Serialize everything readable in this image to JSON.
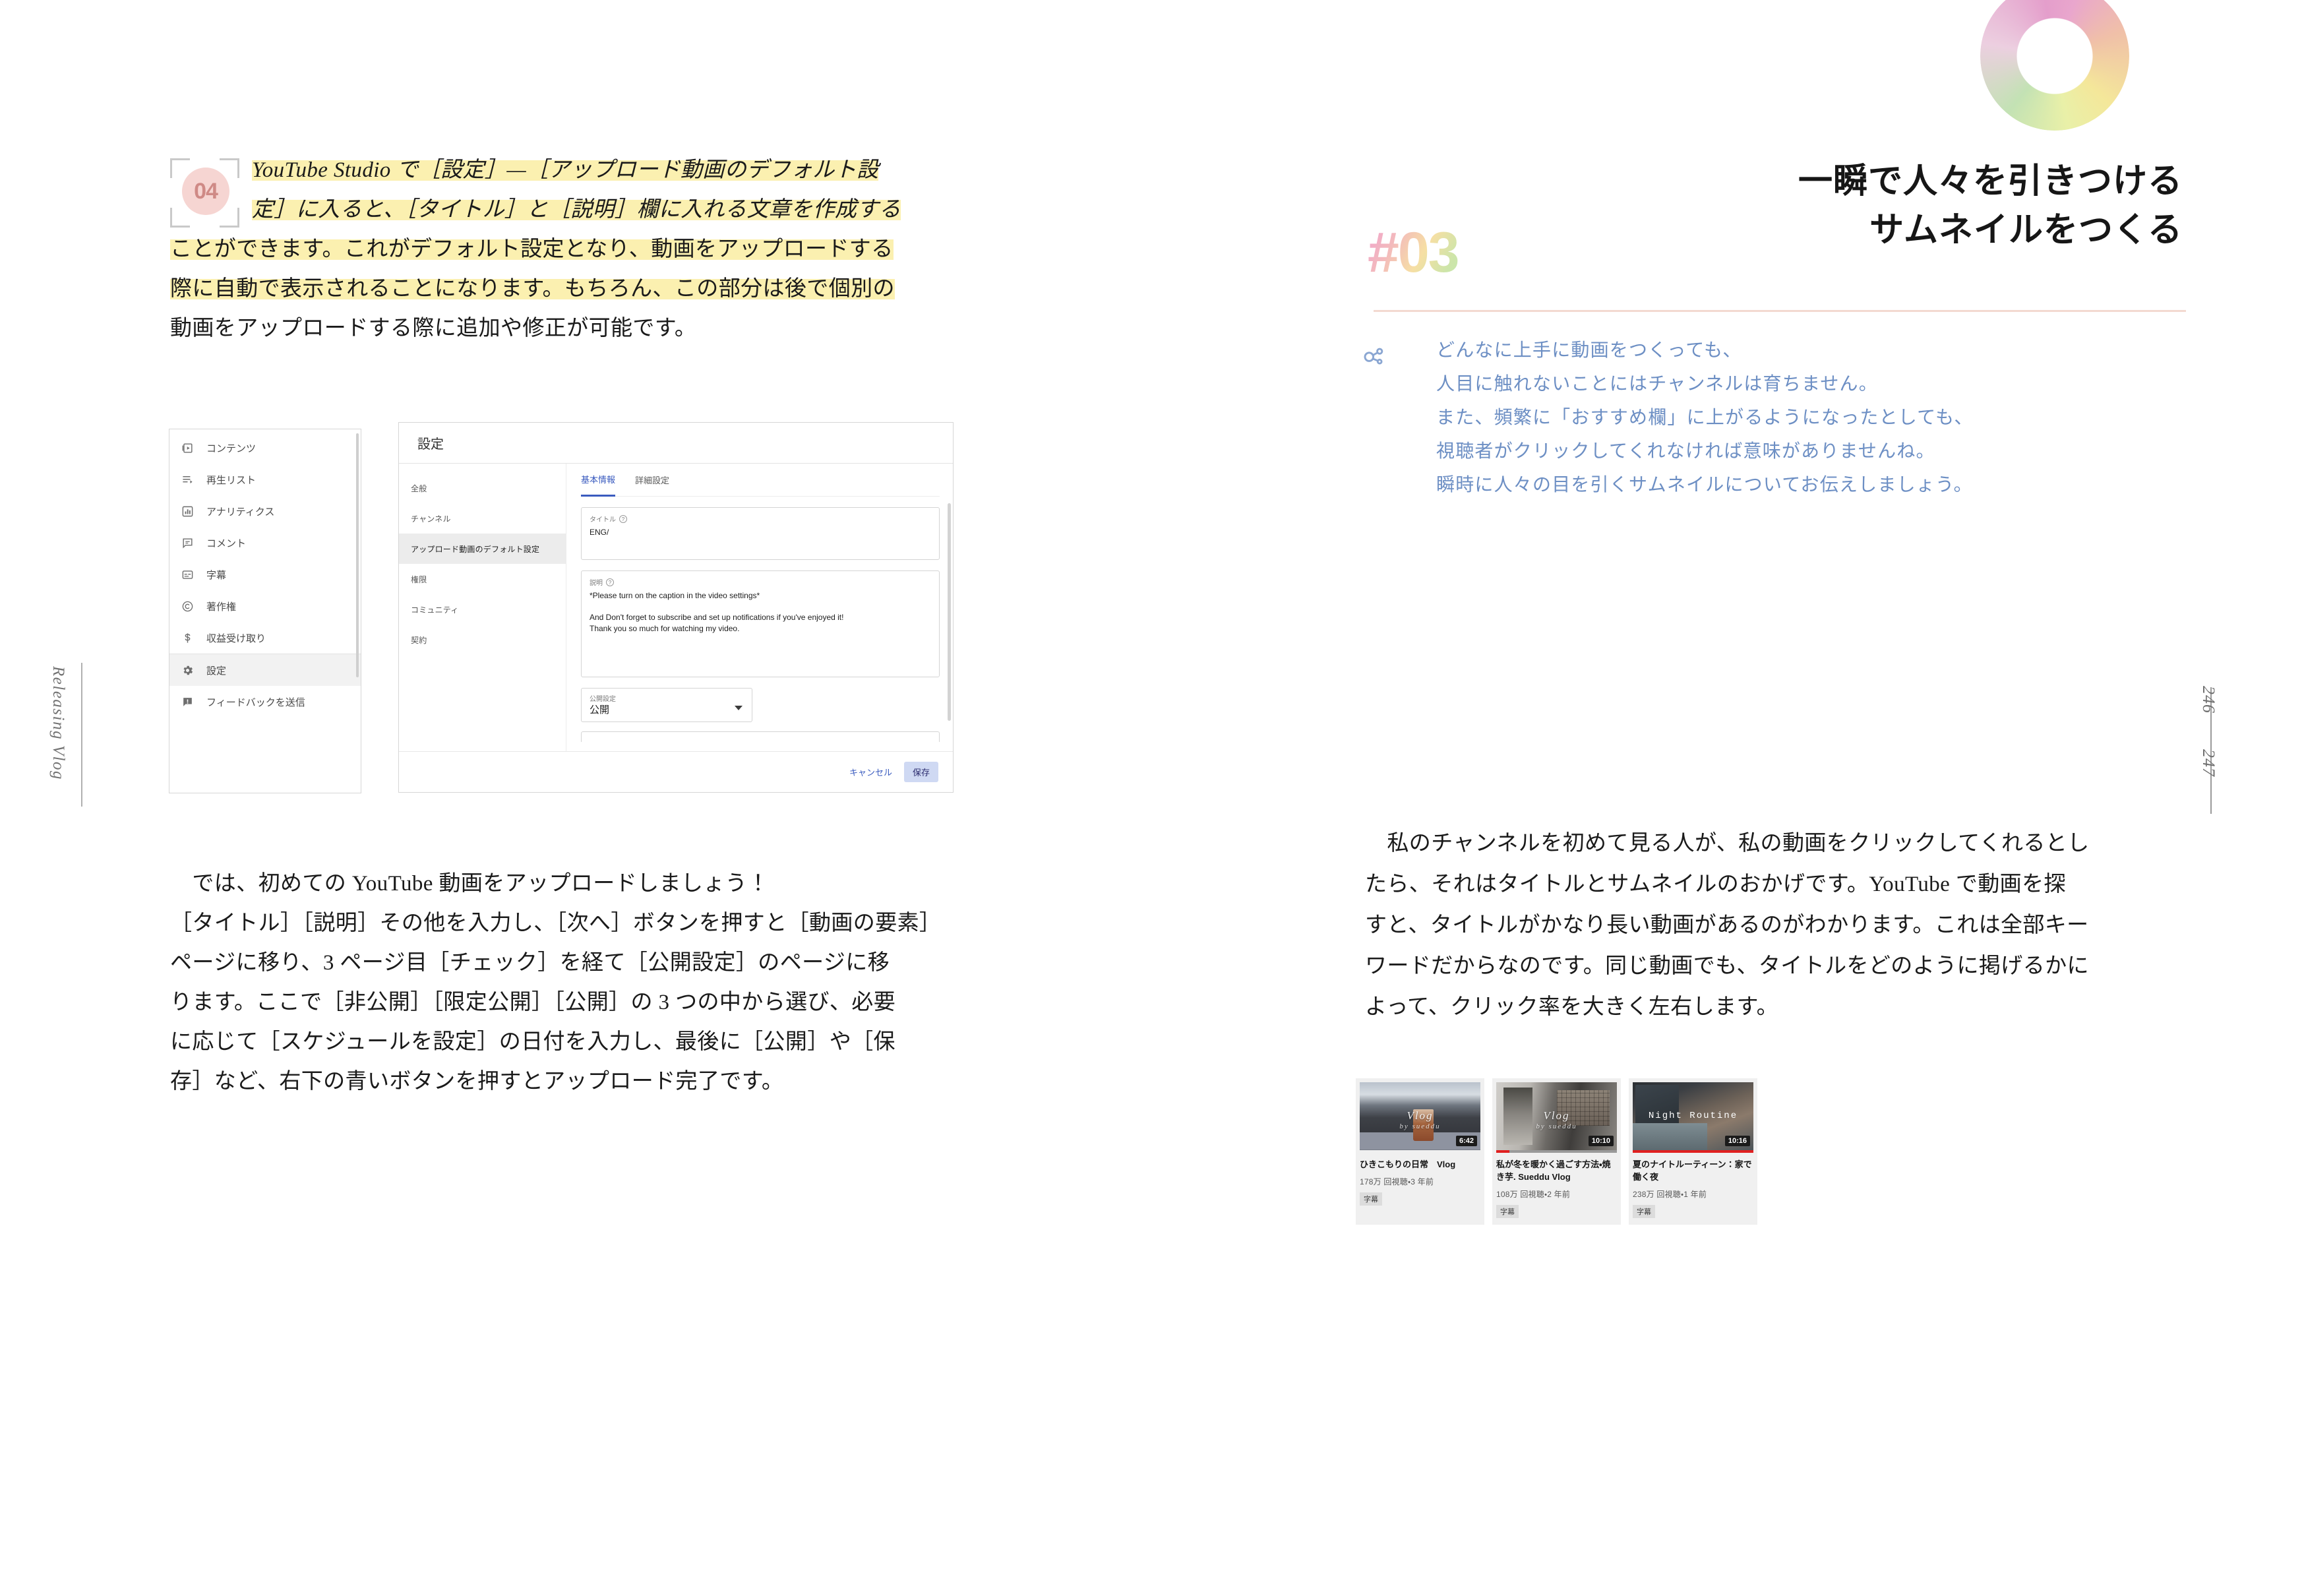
{
  "book": {
    "running_head": "Releasing Vlog",
    "page_left": "246",
    "page_right": "247"
  },
  "left_page": {
    "marker_number": "04",
    "lead_lines": [
      "YouTube Studio で［設定］—［アップロード動画のデフォルト設",
      "定］に入ると、［タイトル］と［説明］欄に入れる文章を作成する",
      "ことができます。これがデフォルト設定となり、動画をアップロードする",
      "際に自動で表示されることになります。もちろん、この部分は後で個別の",
      "動画をアップロードする際に追加や修正が可能です。"
    ],
    "body_lines": [
      "　では、初めての YouTube 動画をアップロードしましょう！",
      "［タイトル］［説明］その他を入力し、［次へ］ボタンを押すと［動画の要素］",
      "ページに移り、3 ページ目［チェック］を経て［公開設定］のページに移",
      "ります。ここで［非公開］［限定公開］［公開］の 3 つの中から選び、必要",
      "に応じて［スケジュールを設定］の日付を入力し、最後に［公開］や［保",
      "存］など、右下の青いボタンを押すとアップロード完了です。"
    ]
  },
  "figure": {
    "sidebar": {
      "items": [
        {
          "label": "コンテンツ",
          "icon": "content-icon"
        },
        {
          "label": "再生リスト",
          "icon": "playlist-icon"
        },
        {
          "label": "アナリティクス",
          "icon": "analytics-icon"
        },
        {
          "label": "コメント",
          "icon": "comment-icon"
        },
        {
          "label": "字幕",
          "icon": "subtitles-icon"
        },
        {
          "label": "著作権",
          "icon": "copyright-icon"
        },
        {
          "label": "収益受け取り",
          "icon": "monetization-icon"
        },
        {
          "label": "設定",
          "icon": "gear-icon"
        },
        {
          "label": "フィードバックを送信",
          "icon": "feedback-icon"
        }
      ]
    },
    "dialog": {
      "title": "設定",
      "nav": [
        "全般",
        "チャンネル",
        "アップロード動画のデフォルト設定",
        "権限",
        "コミュニティ",
        "契約"
      ],
      "nav_active": "アップロード動画のデフォルト設定",
      "tabs": [
        "基本情報",
        "詳細設定"
      ],
      "tab_active": "基本情報",
      "title_field": {
        "label": "タイトル",
        "value": "ENG/"
      },
      "desc_field": {
        "label": "説明",
        "line1": "*Please turn on the caption in the video settings*",
        "line2": "And Don't forget to subscribe and set up notifications if you've enjoyed it!",
        "line3": "Thank you so much for watching my video."
      },
      "visibility": {
        "label": "公開設定",
        "value": "公開"
      },
      "cancel": "キャンセル",
      "save": "保存"
    }
  },
  "right_page": {
    "section_number": "#03",
    "heading_lines": [
      "一瞬で人々を引きつける",
      "サムネイルをつくる"
    ],
    "intro_lines": [
      "どんなに上手に動画をつくっても、",
      "人目に触れないことにはチャンネルは育ちません。",
      "また、頻繁に「おすすめ欄」に上がるようになったとしても、",
      "視聴者がクリックしてくれなければ意味がありませんね。",
      "瞬時に人々の目を引くサムネイルについてお伝えしましょう。"
    ],
    "body_lines": [
      "　私のチャンネルを初めて見る人が、私の動画をクリックしてくれるとし",
      "たら、それはタイトルとサムネイルのおかげです。YouTube で動画を探",
      "すと、タイトルがかなり長い動画があるのがわかります。これは全部キー",
      "ワードだからなのです。同じ動画でも、タイトルをどのように掲げるかに",
      "よって、クリック率を大きく左右します。"
    ],
    "video_cards": [
      {
        "duration": "6:42",
        "overlay_text": "Vlog",
        "overlay_sub": "by sueddu",
        "title": "ひきこもりの日常　Vlog",
        "meta": "178万 回視聴・3 年前",
        "badge": "字幕",
        "progress_pct": 0
      },
      {
        "duration": "10:10",
        "overlay_text": "Vlog",
        "overlay_sub": "by sueddu",
        "title": "私が冬を暖かく過ごす方法・焼き芋. Sueddu Vlog",
        "meta": "108万 回視聴・2 年前",
        "badge": "字幕",
        "progress_pct": 11
      },
      {
        "duration": "10:16",
        "overlay_text": "Night Routine",
        "overlay_sub": "",
        "title": "夏のナイトルーティーン：家で働く夜",
        "meta": "238万 回視聴・1 年前",
        "badge": "字幕",
        "progress_pct": 100
      }
    ]
  },
  "colors": {
    "highlight": "#fbf0b0",
    "marker_bg": "#f6d5d2",
    "marker_fg": "#cf8a86",
    "intro_blue": "#6d8fc4",
    "rule_pink": "#f3d9d0",
    "youtube_red": "#e02020",
    "accent_blue": "#3a5bbf"
  }
}
